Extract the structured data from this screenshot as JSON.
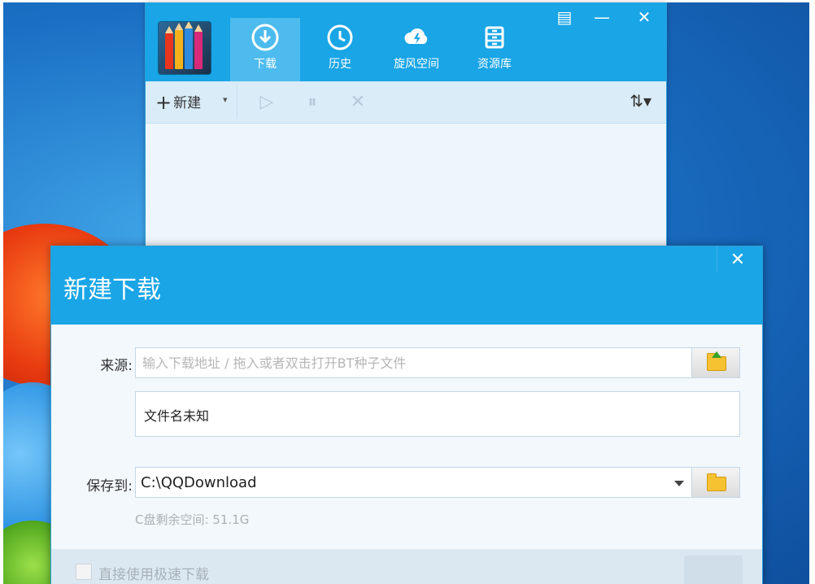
{
  "main_window": {
    "nav_tabs": [
      {
        "label": "下载",
        "icon": "download-icon",
        "active": true
      },
      {
        "label": "历史",
        "icon": "history-icon",
        "active": false
      },
      {
        "label": "旋风空间",
        "icon": "cloud-icon",
        "active": false
      },
      {
        "label": "资源库",
        "icon": "library-icon",
        "active": false
      }
    ],
    "toolbar": {
      "new_label": "新建",
      "plus_glyph": "+",
      "dropdown_glyph": "▾",
      "start_glyph": "▷",
      "pause_glyph": "⏸",
      "delete_glyph": "✕",
      "sort_glyph": "⇅▾"
    },
    "controls": {
      "skin_glyph": "▤",
      "minimize_glyph": "—",
      "close_glyph": "✕"
    }
  },
  "dialog": {
    "title": "新建下载",
    "close_glyph": "✕",
    "source_label": "来源:",
    "source_placeholder": "输入下载地址 / 拖入或者双击打开BT种子文件",
    "source_value": "",
    "filename": "文件名未知",
    "save_label": "保存到:",
    "save_path": "C:\\QQDownload",
    "free_space": "C盘剩余空间: 51.1G",
    "checkbox_label": "直接使用极速下载"
  },
  "colors": {
    "header_blue": "#19a5e6",
    "active_tab": "#4dbbee",
    "toolbar_bg": "#d9ecf8",
    "folder_yellow": "#f6c232"
  }
}
